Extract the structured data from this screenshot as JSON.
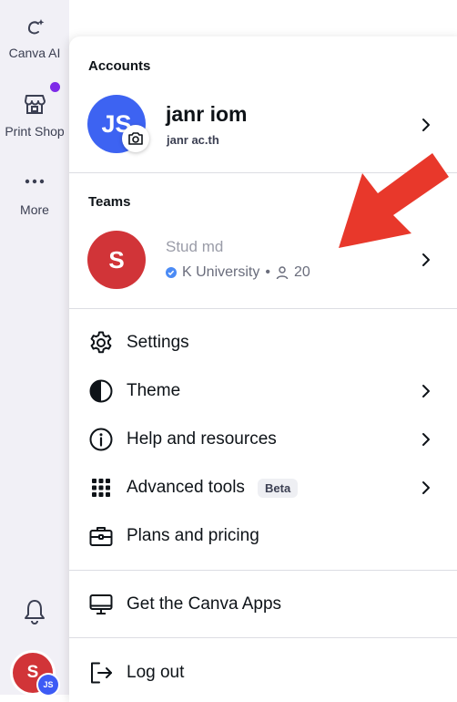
{
  "rail": {
    "items": [
      {
        "label": "Canva AI",
        "icon": "canva-ai-icon"
      },
      {
        "label": "Print Shop",
        "icon": "print-shop-icon"
      },
      {
        "label": "More",
        "icon": "more-dots-icon"
      }
    ],
    "avatar_initials": "S",
    "avatar_badge": "JS"
  },
  "menu": {
    "accounts_title": "Accounts",
    "account": {
      "initials": "JS",
      "name": "janr          iom",
      "email": "janr           ac.th"
    },
    "teams_title": "Teams",
    "team": {
      "initials": "S",
      "name": "Stud          md",
      "org": "K          University",
      "separator": "•",
      "members": "20"
    },
    "items": [
      {
        "label": "Settings",
        "icon": "gear-icon"
      },
      {
        "label": "Theme",
        "icon": "contrast-icon"
      },
      {
        "label": "Help and resources",
        "icon": "info-icon"
      },
      {
        "label": "Advanced tools",
        "icon": "grid-dots-icon",
        "badge": "Beta"
      },
      {
        "label": "Plans and pricing",
        "icon": "briefcase-icon"
      },
      {
        "label": "Get the Canva Apps",
        "icon": "monitor-icon"
      },
      {
        "label": "Log out",
        "icon": "logout-icon"
      }
    ]
  },
  "colors": {
    "accent_purple": "#7d2ae8",
    "account_avatar": "#3d63f2",
    "team_avatar": "#d13438",
    "annotation_arrow": "#e8382b"
  }
}
